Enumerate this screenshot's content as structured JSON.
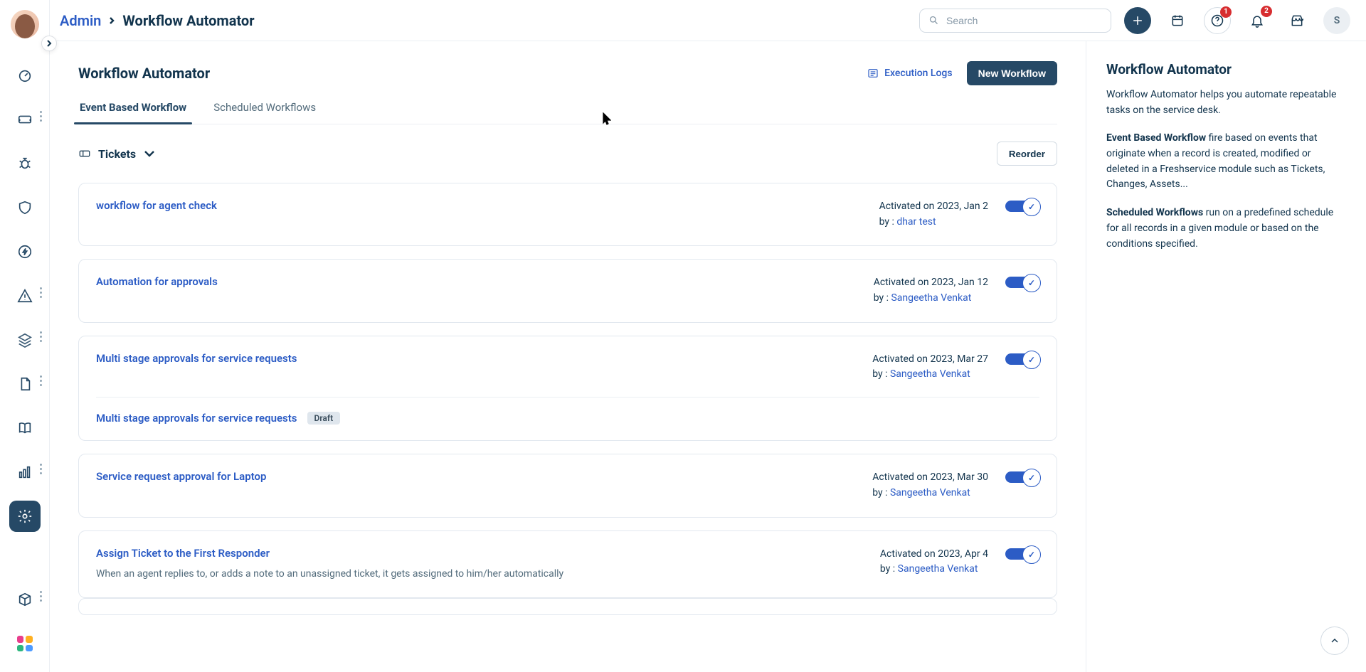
{
  "breadcrumb": {
    "root": "Admin",
    "page": "Workflow Automator"
  },
  "search": {
    "placeholder": "Search"
  },
  "topbar": {
    "notif_badge": "2",
    "help_badge": "1",
    "avatar_initial": "S"
  },
  "content": {
    "title": "Workflow Automator",
    "exec_logs": "Execution Logs",
    "new_workflow": "New Workflow",
    "tabs": {
      "event": "Event Based Workflow",
      "scheduled": "Scheduled Workflows"
    },
    "module": "Tickets",
    "reorder": "Reorder"
  },
  "workflows": [
    {
      "title": "workflow for agent check",
      "activated": "Activated on 2023, Jan 2",
      "by_prefix": "by : ",
      "user": "dhar test",
      "desc": "",
      "draft_child": null
    },
    {
      "title": "Automation for approvals",
      "activated": "Activated on 2023, Jan 12",
      "by_prefix": "by : ",
      "user": "Sangeetha Venkat",
      "desc": "",
      "draft_child": null
    },
    {
      "title": "Multi stage approvals for service requests",
      "activated": "Activated on 2023, Mar 27",
      "by_prefix": "by : ",
      "user": "Sangeetha Venkat",
      "desc": "",
      "draft_child": {
        "title": "Multi stage approvals for service requests",
        "badge": "Draft"
      }
    },
    {
      "title": "Service request approval for Laptop",
      "activated": "Activated on 2023, Mar 30",
      "by_prefix": "by : ",
      "user": "Sangeetha Venkat",
      "desc": "",
      "draft_child": null
    },
    {
      "title": "Assign Ticket to the First Responder",
      "activated": "Activated on 2023, Apr 4",
      "by_prefix": "by : ",
      "user": "Sangeetha Venkat",
      "desc": "When an agent replies to, or adds a note to an unassigned ticket, it gets assigned to him/her automatically",
      "draft_child": null
    }
  ],
  "sidepanel": {
    "title": "Workflow Automator",
    "intro": "Workflow Automator helps you automate repeatable tasks on the service desk.",
    "event_head": "Event Based Workflow",
    "event_body": " fire based on events that originate when a record is created, modified or deleted in a Freshservice module such as Tickets, Changes, Assets...",
    "sched_head": "Scheduled Workflows",
    "sched_body": " run on a predefined schedule for all records in a given module or based on the conditions specified."
  }
}
